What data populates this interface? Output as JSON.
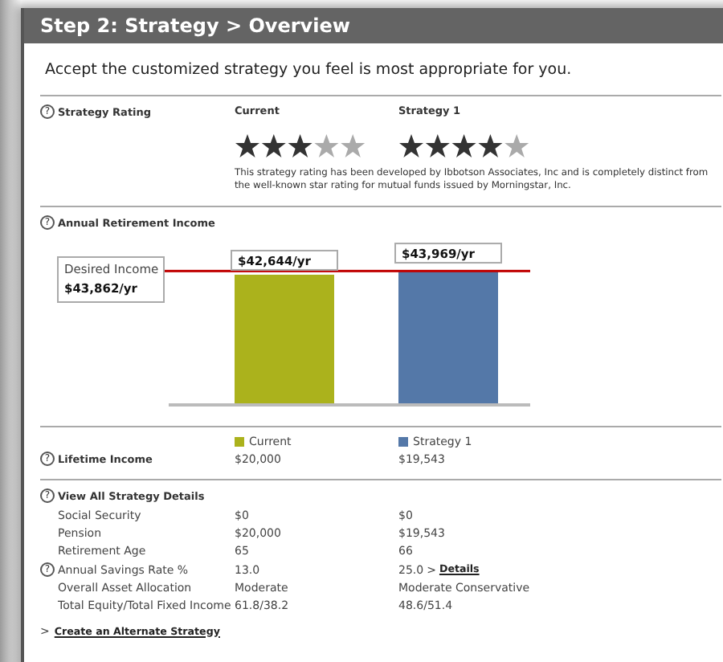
{
  "header": {
    "title": "Step 2: Strategy > Overview"
  },
  "intro": "Accept the customized strategy you feel is most appropriate for you.",
  "rating": {
    "help": "?",
    "label": "Strategy Rating",
    "columns": [
      {
        "heading": "Current",
        "stars": 3
      },
      {
        "heading": "Strategy 1",
        "stars": 4
      }
    ],
    "note": "This strategy rating has been developed by Ibbotson Associates, Inc and is completely distinct from\nthe well-known star rating for mutual funds issued by Morningstar, Inc."
  },
  "income": {
    "help": "?",
    "label": "Annual Retirement Income",
    "desired": {
      "label": "Desired Income",
      "amount": "$43,862/yr"
    },
    "bars": [
      {
        "name": "Current",
        "color": "#abb21c",
        "amount": "$42,644/yr",
        "level": 0.755
      },
      {
        "name": "Strategy 1",
        "color": "#5478a8",
        "amount": "$43,969/yr",
        "level": 0.778
      }
    ]
  },
  "lifetime": {
    "help": "?",
    "label": "Lifetime Income",
    "values": [
      "$20,000",
      "$19,543"
    ]
  },
  "details": {
    "help": "?",
    "label": "View All Strategy Details",
    "rows": [
      {
        "label": "Social Security",
        "values": [
          "$0",
          "$0"
        ]
      },
      {
        "label": "Pension",
        "values": [
          "$20,000",
          "$19,543"
        ]
      },
      {
        "label": "Retirement Age",
        "values": [
          "65",
          "66"
        ]
      },
      {
        "help": "?",
        "label": "Annual Savings Rate %",
        "values": [
          "13.0",
          "25.0"
        ],
        "link": {
          "prefix": ">",
          "label": "Details"
        }
      },
      {
        "label": "Overall Asset Allocation",
        "values": [
          "Moderate",
          "Moderate Conservative"
        ]
      },
      {
        "label": "Total Equity/Total Fixed Income",
        "values": [
          "61.8/38.2",
          "48.6/51.4"
        ]
      }
    ]
  },
  "create_link": {
    "prefix": ">",
    "label": "Create an Alternate Strategy"
  }
}
